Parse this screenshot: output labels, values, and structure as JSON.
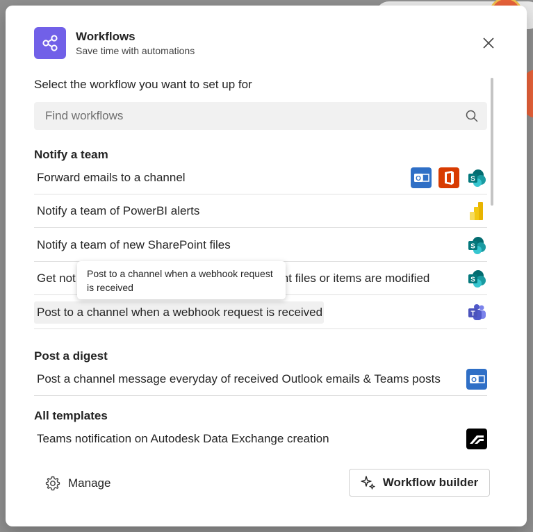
{
  "dialog": {
    "title": "Workflows",
    "subtitle": "Save time with automations",
    "prompt": "Select the workflow you want to set up for",
    "search": {
      "placeholder": "Find workflows"
    }
  },
  "sections": {
    "notify": {
      "heading": "Notify a team",
      "items": [
        {
          "label": "Forward emails to a channel",
          "icons": [
            "outlook-icon",
            "office-icon",
            "sharepoint-icon"
          ]
        },
        {
          "label": "Notify a team of PowerBI alerts",
          "icons": [
            "powerbi-icon"
          ]
        },
        {
          "label": "Notify a team of new SharePoint files",
          "icons": [
            "sharepoint-icon"
          ]
        },
        {
          "label_left": "Get not",
          "label_right": "int files or items are modified",
          "icons": [
            "sharepoint-icon"
          ]
        },
        {
          "label": "Post to a channel when a webhook request is received",
          "icons": [
            "teams-icon"
          ]
        }
      ]
    },
    "digest": {
      "heading": "Post a digest",
      "items": [
        {
          "label": "Post a channel message everyday of received Outlook emails & Teams posts",
          "icons": [
            "outlook-icon"
          ]
        }
      ]
    },
    "all": {
      "heading": "All templates",
      "items": [
        {
          "label": "Teams notification on Autodesk Data Exchange creation",
          "icons": [
            "autodesk-icon"
          ]
        }
      ]
    }
  },
  "tooltip": {
    "text": "Post to a channel when a webhook request is received"
  },
  "footer": {
    "manage_label": "Manage",
    "builder_label": "Workflow builder"
  },
  "colors": {
    "app_tile": "#7160e8",
    "outlook": "#2f6fc6",
    "office": "#d83b01",
    "sharepoint": "#038387",
    "powerbi": "#f2c811",
    "teams": "#5b5fc7",
    "autodesk": "#000000"
  }
}
